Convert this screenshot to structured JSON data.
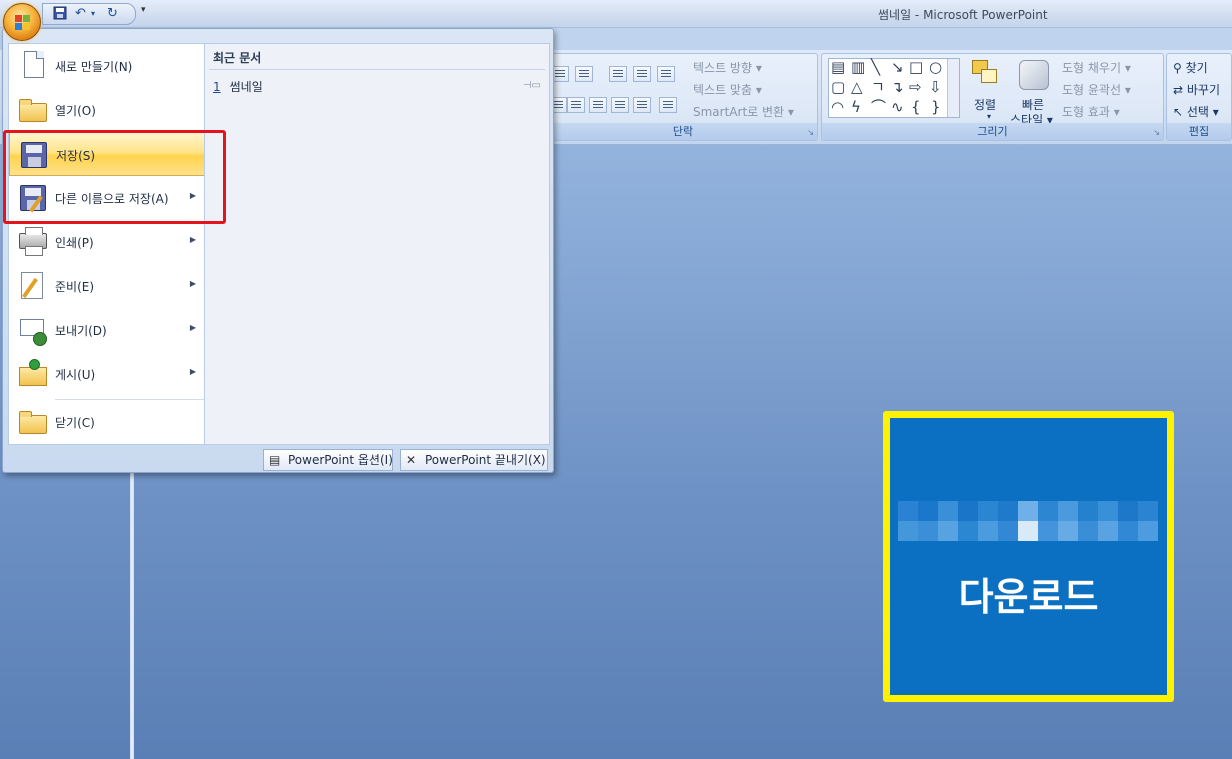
{
  "window": {
    "title": "썸네일 - Microsoft PowerPoint"
  },
  "qat": {
    "save_icon": "save-icon",
    "undo_icon": "undo-icon",
    "redo_icon": "redo-icon"
  },
  "ribbon": {
    "paragraph": {
      "label": "단락",
      "text_direction": "텍스트 방향 ▾",
      "align_text": "텍스트 맞춤 ▾",
      "smartart": "SmartArt로 변환 ▾"
    },
    "drawing": {
      "label": "그리기",
      "arrange": "정렬",
      "quick_styles_line1": "빠른",
      "quick_styles_line2": "스타일 ▾",
      "shape_fill": "도형 채우기 ▾",
      "shape_outline": "도형 윤곽선 ▾",
      "shape_effects": "도형 효과 ▾"
    },
    "editing": {
      "label": "편집",
      "find": "찾기",
      "replace": "바꾸기",
      "select": "선택 ▾"
    }
  },
  "office_menu": {
    "items": [
      {
        "label": "새로 만들기(N)",
        "icon": "new-document-icon"
      },
      {
        "label": "열기(O)",
        "icon": "open-folder-icon"
      },
      {
        "label": "저장(S)",
        "icon": "save-icon"
      },
      {
        "label": "다른 이름으로 저장(A)",
        "icon": "save-as-icon"
      },
      {
        "label": "인쇄(P)",
        "icon": "print-icon"
      },
      {
        "label": "준비(E)",
        "icon": "prepare-icon"
      },
      {
        "label": "보내기(D)",
        "icon": "send-icon"
      },
      {
        "label": "게시(U)",
        "icon": "publish-icon"
      },
      {
        "label": "닫기(C)",
        "icon": "close-folder-icon"
      }
    ],
    "recent": {
      "title": "최근 문서",
      "items": [
        {
          "number": "1",
          "name": "썸네일"
        }
      ]
    },
    "options_button": "PowerPoint 옵션(I)",
    "exit_button": "PowerPoint 끝내기(X)"
  },
  "slide": {
    "download_text": "다운로드",
    "colors": {
      "frame": "#fff200",
      "tile": "#0b6fc2",
      "highlight_box": "#e3141b"
    }
  }
}
